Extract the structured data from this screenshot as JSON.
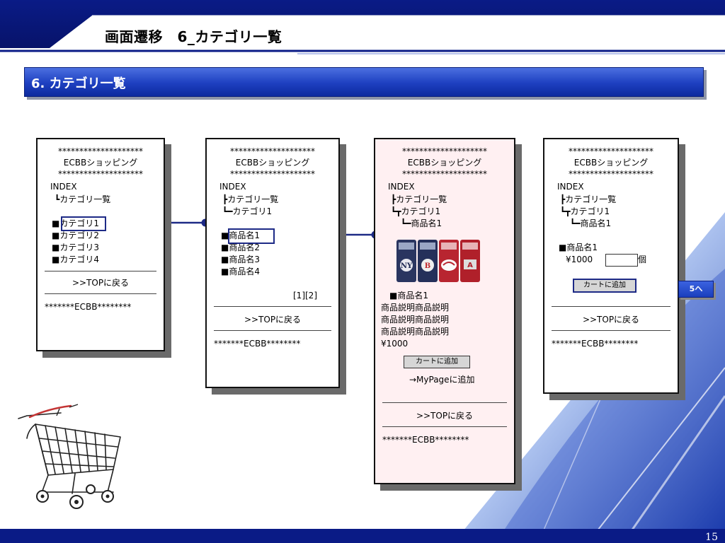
{
  "slide": {
    "title": "画面遷移　6_カテゴリ一覧",
    "section_title": "6. カテゴリ一覧",
    "page_number": "15",
    "next_label": "5へ"
  },
  "common": {
    "stars": "********************",
    "shop_name": "ECBBショッピング",
    "index": "INDEX",
    "back_top": ">>TOPに戻る",
    "footer": "*******ECBB********",
    "dashes": "-----------------------------"
  },
  "screen1": {
    "crumb1": "┗カテゴリ一覧",
    "items": [
      "■カテゴリ1",
      "■カテゴリ2",
      "■カテゴリ3",
      "■カテゴリ4"
    ]
  },
  "screen2": {
    "crumb1": "┣カテゴリ一覧",
    "crumb2": "┗━カテゴリ1",
    "items": [
      "■商品名1",
      "■商品名2",
      "■商品名3",
      "■商品名4"
    ],
    "pager": "[1][2]"
  },
  "screen3": {
    "crumb1": "┣カテゴリ一覧",
    "crumb2": "┗┳カテゴリ1",
    "crumb3": "┗━商品名1",
    "product_name": "■商品名1",
    "desc": [
      "商品説明商品説明",
      "商品説明商品説明",
      "商品説明商品説明"
    ],
    "price": "¥1000",
    "cart_button": "カートに追加",
    "mypage": "→MyPageに追加"
  },
  "screen4": {
    "crumb1": "┣カテゴリ一覧",
    "crumb2": "┗┳カテゴリ1",
    "crumb3": "┗━商品名1",
    "product_name": "■商品名1",
    "price": "¥1000",
    "qty_unit": "個",
    "cart_button": "カートに追加"
  }
}
